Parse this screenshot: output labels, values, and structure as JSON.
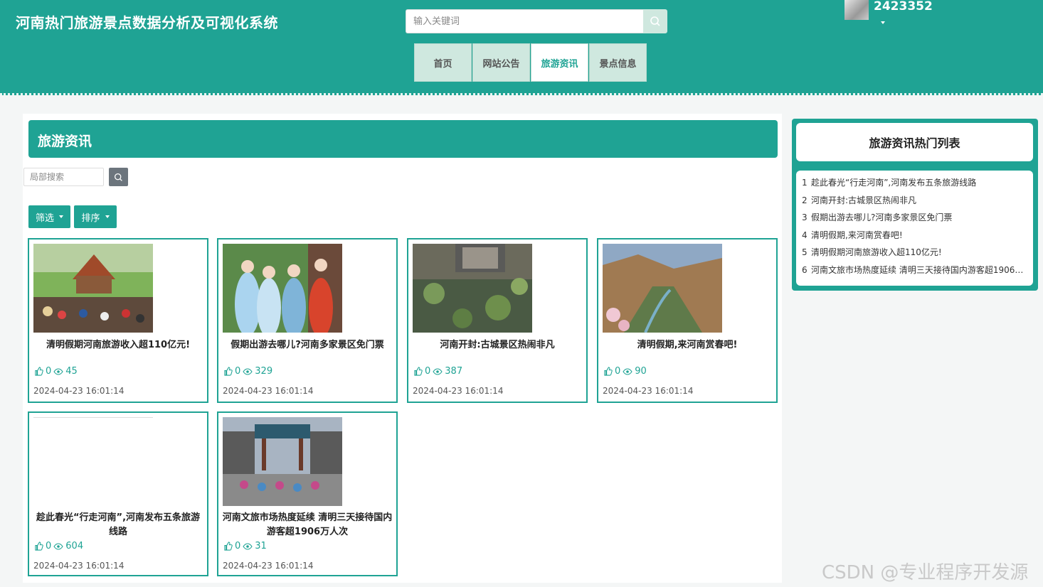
{
  "header": {
    "site_title": "河南热门旅游景点数据分析及可视化系统",
    "search_placeholder": "输入关键词",
    "username": "2423352"
  },
  "nav": [
    {
      "label": "首页",
      "active": false
    },
    {
      "label": "网站公告",
      "active": false
    },
    {
      "label": "旅游资讯",
      "active": true
    },
    {
      "label": "景点信息",
      "active": false
    }
  ],
  "main": {
    "section_title": "旅游资讯",
    "local_search_placeholder": "局部搜索",
    "filter_label": "筛选",
    "sort_label": "排序",
    "cards": [
      {
        "title": "清明假期河南旅游收入超110亿元!",
        "likes": "0",
        "views": "45",
        "date": "2024-04-23 16:01:14"
      },
      {
        "title": "假期出游去哪儿?河南多家景区免门票",
        "likes": "0",
        "views": "329",
        "date": "2024-04-23 16:01:14"
      },
      {
        "title": "河南开封:古城景区热闹非凡",
        "likes": "0",
        "views": "387",
        "date": "2024-04-23 16:01:14"
      },
      {
        "title": "清明假期,来河南赏春吧!",
        "likes": "0",
        "views": "90",
        "date": "2024-04-23 16:01:14"
      },
      {
        "title": "趁此春光“行走河南”,河南发布五条旅游线路",
        "likes": "0",
        "views": "604",
        "date": "2024-04-23 16:01:14"
      },
      {
        "title": "河南文旅市场热度延续 清明三天接待国内游客超1906万人次",
        "likes": "0",
        "views": "31",
        "date": "2024-04-23 16:01:14"
      }
    ]
  },
  "sidebar": {
    "title": "旅游资讯热门列表",
    "items": [
      {
        "num": "1",
        "text": "趁此春光“行走河南”,河南发布五条旅游线路"
      },
      {
        "num": "2",
        "text": "河南开封:古城景区热闹非凡"
      },
      {
        "num": "3",
        "text": "假期出游去哪儿?河南多家景区免门票"
      },
      {
        "num": "4",
        "text": "清明假期,来河南赏春吧!"
      },
      {
        "num": "5",
        "text": "清明假期河南旅游收入超110亿元!"
      },
      {
        "num": "6",
        "text": "河南文旅市场热度延续 清明三天接待国内游客超1906万..."
      }
    ]
  },
  "watermark": "CSDN @专业程序开发源"
}
